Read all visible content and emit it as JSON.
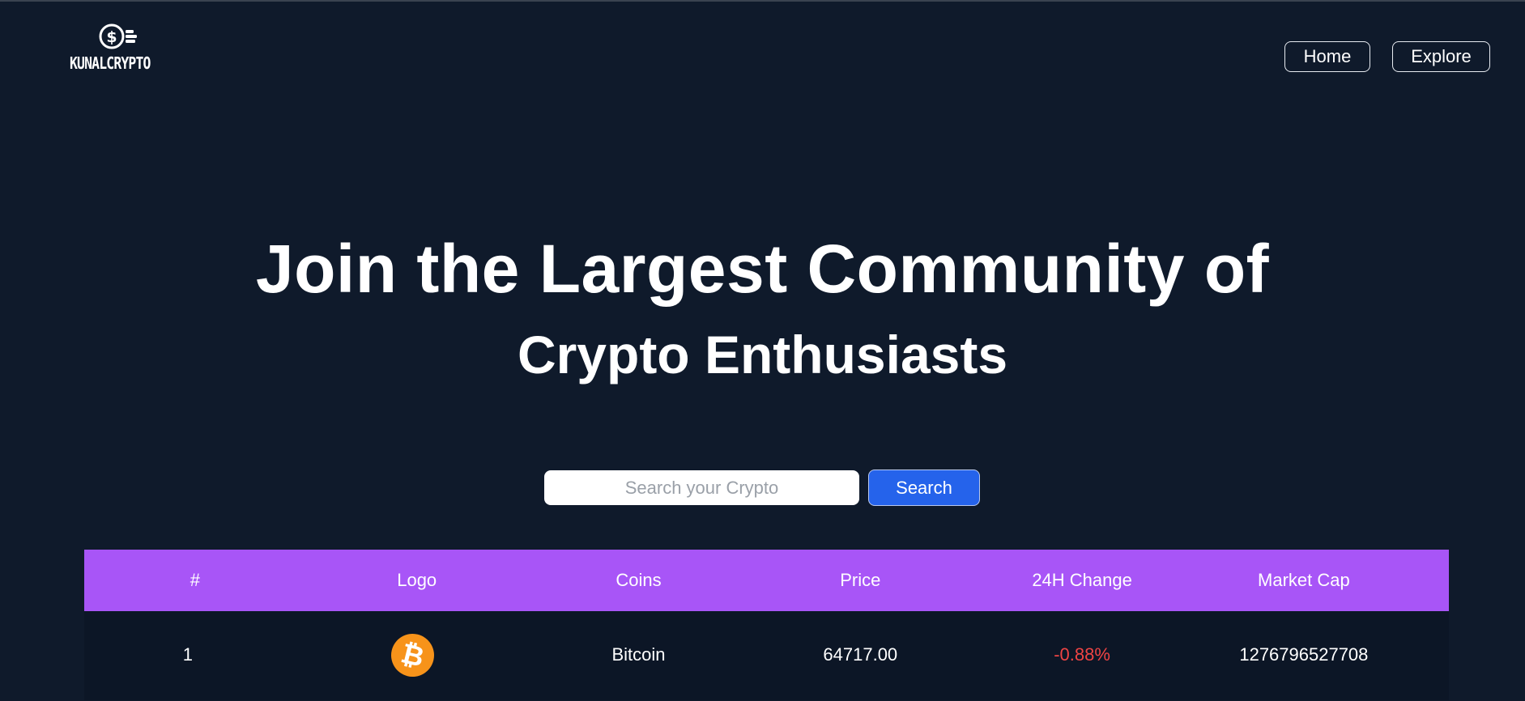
{
  "header": {
    "logo_text": "KUNALCRYPTO",
    "nav": [
      {
        "label": "Home"
      },
      {
        "label": "Explore"
      }
    ]
  },
  "hero": {
    "title": "Join the Largest Community of",
    "subtitle": "Crypto Enthusiasts"
  },
  "search": {
    "placeholder": "Search your Crypto",
    "value": "",
    "button_label": "Search"
  },
  "table": {
    "columns": [
      "#",
      "Logo",
      "Coins",
      "Price",
      "24H Change",
      "Market Cap"
    ],
    "rows": [
      {
        "rank": "1",
        "logo_icon": "bitcoin-icon",
        "logo_glyph": "₿",
        "coin": "Bitcoin",
        "price": "64717.00",
        "change": "-0.88%",
        "market_cap": "1276796527708"
      }
    ]
  },
  "colors": {
    "background": "#0f1a2b",
    "table_header": "#a855f7",
    "search_button": "#2563eb",
    "negative_change": "#ef4444",
    "bitcoin_orange": "#f7931a"
  }
}
